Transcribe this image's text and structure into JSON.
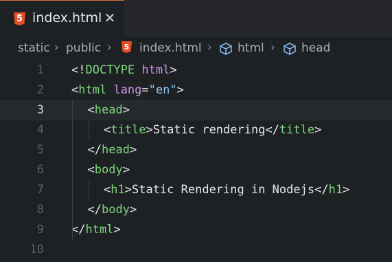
{
  "tab": {
    "icon": "html5-icon",
    "icon_text": "5",
    "label": "index.html",
    "close_glyph": "✕"
  },
  "breadcrumb": {
    "items": [
      "static",
      "public",
      "index.html",
      "html",
      "head"
    ],
    "separator": "›"
  },
  "editor": {
    "active_line": 3,
    "lines": [
      {
        "number": "1",
        "indent": 0,
        "tokens": [
          {
            "t": "p",
            "v": "<!"
          },
          {
            "t": "t",
            "v": "DOCTYPE"
          },
          {
            "t": "p",
            "v": " "
          },
          {
            "t": "a",
            "v": "html"
          },
          {
            "t": "p",
            "v": ">"
          }
        ]
      },
      {
        "number": "2",
        "indent": 0,
        "tokens": [
          {
            "t": "p",
            "v": "<"
          },
          {
            "t": "t",
            "v": "html"
          },
          {
            "t": "p",
            "v": " "
          },
          {
            "t": "a",
            "v": "lang"
          },
          {
            "t": "p",
            "v": "="
          },
          {
            "t": "s",
            "v": "\"en\""
          },
          {
            "t": "p",
            "v": ">"
          }
        ]
      },
      {
        "number": "3",
        "indent": 1,
        "tokens": [
          {
            "t": "p",
            "v": "<"
          },
          {
            "t": "t",
            "v": "head"
          },
          {
            "t": "p",
            "v": ">"
          }
        ]
      },
      {
        "number": "4",
        "indent": 2,
        "tokens": [
          {
            "t": "p",
            "v": "<"
          },
          {
            "t": "t",
            "v": "title"
          },
          {
            "t": "p",
            "v": ">"
          },
          {
            "t": "x",
            "v": "Static rendering"
          },
          {
            "t": "p",
            "v": "</"
          },
          {
            "t": "t",
            "v": "title"
          },
          {
            "t": "p",
            "v": ">"
          }
        ]
      },
      {
        "number": "5",
        "indent": 1,
        "tokens": [
          {
            "t": "p",
            "v": "</"
          },
          {
            "t": "t",
            "v": "head"
          },
          {
            "t": "p",
            "v": ">"
          }
        ]
      },
      {
        "number": "6",
        "indent": 1,
        "tokens": [
          {
            "t": "p",
            "v": "<"
          },
          {
            "t": "t",
            "v": "body"
          },
          {
            "t": "p",
            "v": ">"
          }
        ]
      },
      {
        "number": "7",
        "indent": 2,
        "tokens": [
          {
            "t": "p",
            "v": "<"
          },
          {
            "t": "t",
            "v": "h1"
          },
          {
            "t": "p",
            "v": ">"
          },
          {
            "t": "x",
            "v": "Static Rendering in Nodejs"
          },
          {
            "t": "p",
            "v": "</"
          },
          {
            "t": "t",
            "v": "h1"
          },
          {
            "t": "p",
            "v": ">"
          }
        ]
      },
      {
        "number": "8",
        "indent": 1,
        "tokens": [
          {
            "t": "p",
            "v": "</"
          },
          {
            "t": "t",
            "v": "body"
          },
          {
            "t": "p",
            "v": ">"
          }
        ]
      },
      {
        "number": "9",
        "indent": 0,
        "tokens": [
          {
            "t": "p",
            "v": "</"
          },
          {
            "t": "t",
            "v": "html"
          },
          {
            "t": "p",
            "v": ">"
          }
        ]
      },
      {
        "number": "10",
        "indent": 0,
        "tokens": []
      }
    ]
  },
  "colors": {
    "tag": "#7ed47c",
    "attribute": "#c994e6",
    "string": "#8cc8ee",
    "punctuation": "#e6e6e6",
    "html5_badge": "#e44d26",
    "active_tab_border": "#d47040"
  }
}
